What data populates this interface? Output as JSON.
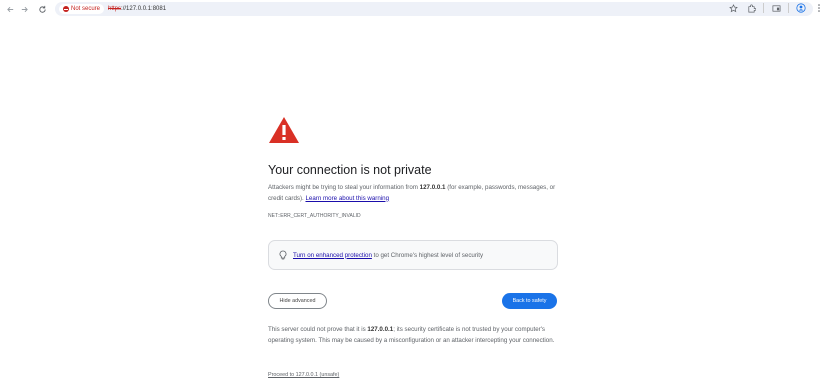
{
  "browser": {
    "nav_icons": [
      "back-icon",
      "forward-icon",
      "reload-icon"
    ],
    "security_chip": "Not secure",
    "url_scheme": "https",
    "url_rest": "://127.0.0.1:8081",
    "right_icons": [
      "star-icon",
      "extensions-icon",
      "tab-search-icon",
      "profile-icon",
      "menu-icon"
    ]
  },
  "page": {
    "heading": "Your connection is not private",
    "intro_part1": "Attackers might be trying to steal your information from ",
    "intro_host": "127.0.0.1",
    "intro_part2": " (for example, passwords, messages, or credit cards). ",
    "learn_more": "Learn more about this warning",
    "error_code": "NET::ERR_CERT_AUTHORITY_INVALID",
    "protection_link": "Turn on enhanced protection",
    "protection_rest": " to get Chrome's highest level of security",
    "hide_advanced": "Hide advanced",
    "back_to_safety": "Back to safety",
    "advanced_part1": "This server could not prove that it is ",
    "advanced_host": "127.0.0.1",
    "advanced_part2": "; its security certificate is not trusted by your computer's operating system. This may be caused by a misconfiguration or an attacker intercepting your connection.",
    "proceed_link": "Proceed to 127.0.0.1 (unsafe)"
  },
  "colors": {
    "warning_red": "#d93025",
    "primary_blue": "#1a73e8",
    "link_blue": "#1a0dab"
  }
}
